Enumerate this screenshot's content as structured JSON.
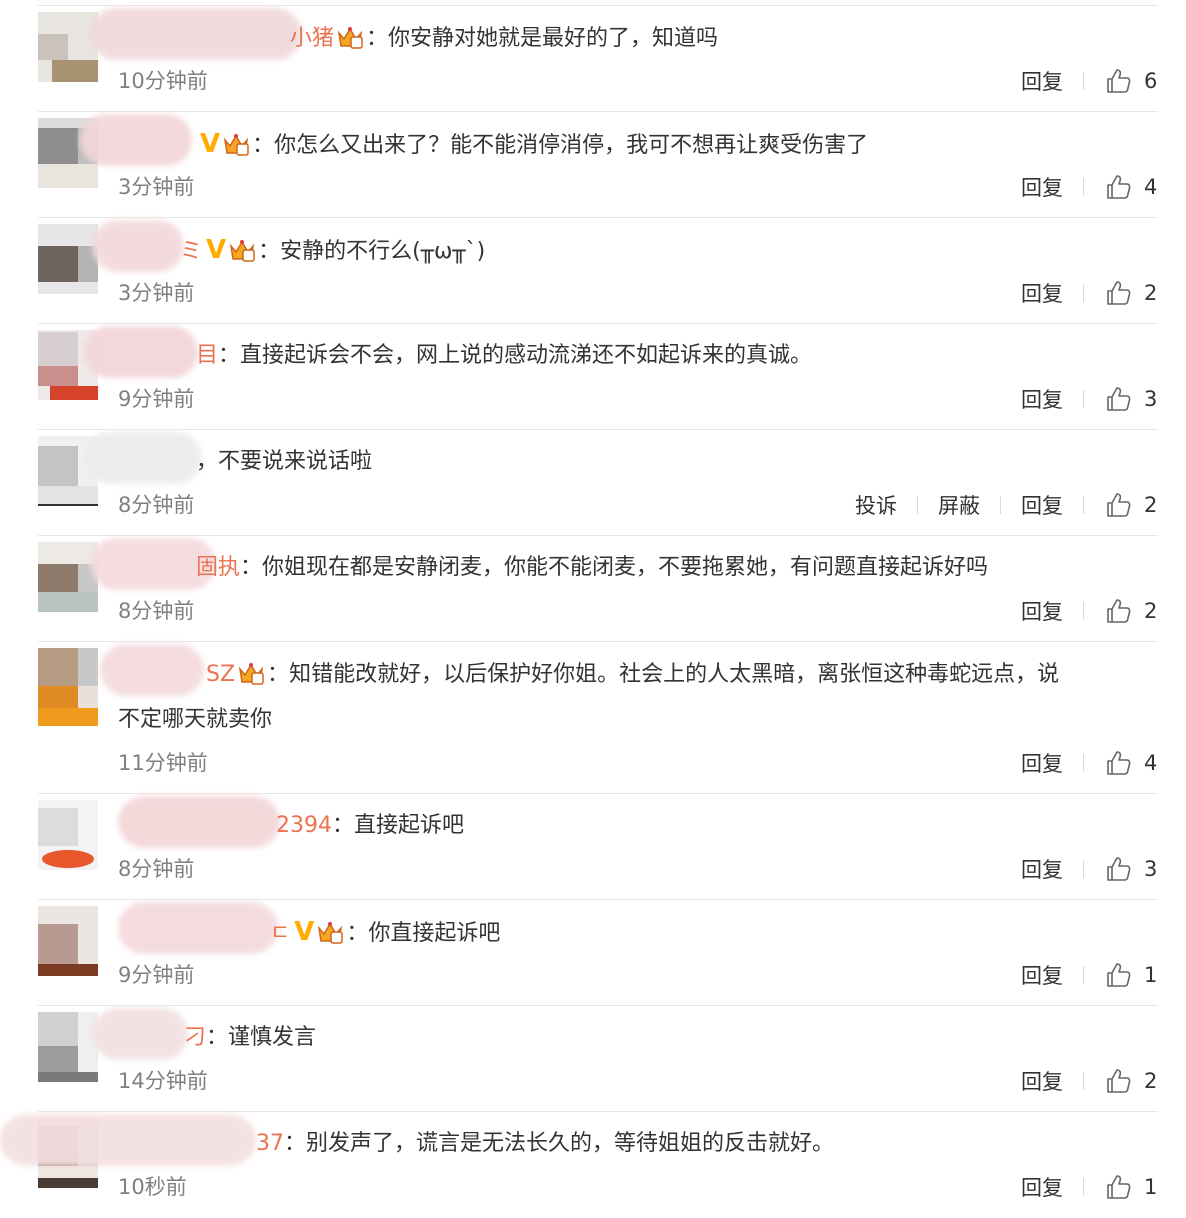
{
  "comments": [
    {
      "name": "小猪",
      "vip": false,
      "text": "你安静对她就是最好的了，知道吗",
      "time": "10分钟前",
      "likes": "6",
      "actions": [
        "回复"
      ]
    },
    {
      "name": "",
      "vip": true,
      "text": "你怎么又出来了？能不能消停消停，我可不想再让爽受伤害了",
      "time": "3分钟前",
      "likes": "4",
      "actions": [
        "回复"
      ]
    },
    {
      "name": "ミ",
      "vip": true,
      "text": "安静的不行么(╥ω╥`)",
      "time": "3分钟前",
      "likes": "2",
      "actions": [
        "回复"
      ]
    },
    {
      "name": "目",
      "vip": false,
      "text": "直接起诉会不会，网上说的感动流涕还不如起诉来的真诚。",
      "time": "9分钟前",
      "likes": "3",
      "actions": [
        "回复"
      ]
    },
    {
      "name": "",
      "vip": false,
      "text": "不要说来说话啦",
      "time": "8分钟前",
      "likes": "2",
      "actions": [
        "投诉",
        "屏蔽",
        "回复"
      ]
    },
    {
      "name": "固执",
      "vip": false,
      "text": "你姐现在都是安静闭麦，你能不能闭麦，不要拖累她，有问题直接起诉好吗",
      "time": "8分钟前",
      "likes": "2",
      "actions": [
        "回复"
      ]
    },
    {
      "name": "SZ",
      "vip": false,
      "text": "知错能改就好，以后保护好你姐。社会上的人太黑暗，离张恒这种毒蛇远点，说",
      "text2": "不定哪天就卖你",
      "time": "11分钟前",
      "likes": "4",
      "actions": [
        "回复"
      ]
    },
    {
      "name": "2394",
      "vip": false,
      "text": "直接起诉吧",
      "time": "8分钟前",
      "likes": "3",
      "actions": [
        "回复"
      ]
    },
    {
      "name": "ㄷ",
      "vip": true,
      "text": "你直接起诉吧",
      "time": "9分钟前",
      "likes": "1",
      "actions": [
        "回复"
      ]
    },
    {
      "name": "刁",
      "vip": false,
      "text": "谨慎发言",
      "time": "14分钟前",
      "likes": "2",
      "actions": [
        "回复"
      ]
    },
    {
      "name": "37",
      "vip": false,
      "text": "别发声了，谎言是无法长久的，等待姐姐的反击就好。",
      "time": "10秒前",
      "likes": "1",
      "actions": [
        "回复"
      ]
    }
  ],
  "colors": {
    "name": "#eb7350",
    "vip": "#ffab00",
    "meta": "#808080",
    "separator": "#e6e6e6"
  },
  "icons": {
    "like": "thumbs-up-icon",
    "member": "crown-icon"
  }
}
